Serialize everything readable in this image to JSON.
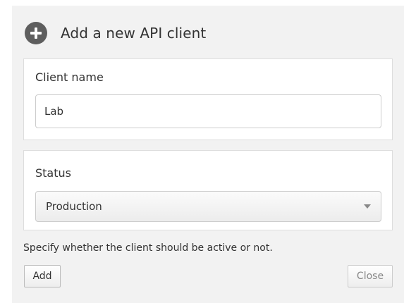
{
  "dialog": {
    "title": "Add a new API client",
    "icon": "plus-circle-icon"
  },
  "client_name": {
    "label": "Client name",
    "value": "Lab"
  },
  "status": {
    "label": "Status",
    "selected": "Production",
    "help_text": "Specify whether the client should be active or not."
  },
  "actions": {
    "add_label": "Add",
    "close_label": "Close"
  }
}
